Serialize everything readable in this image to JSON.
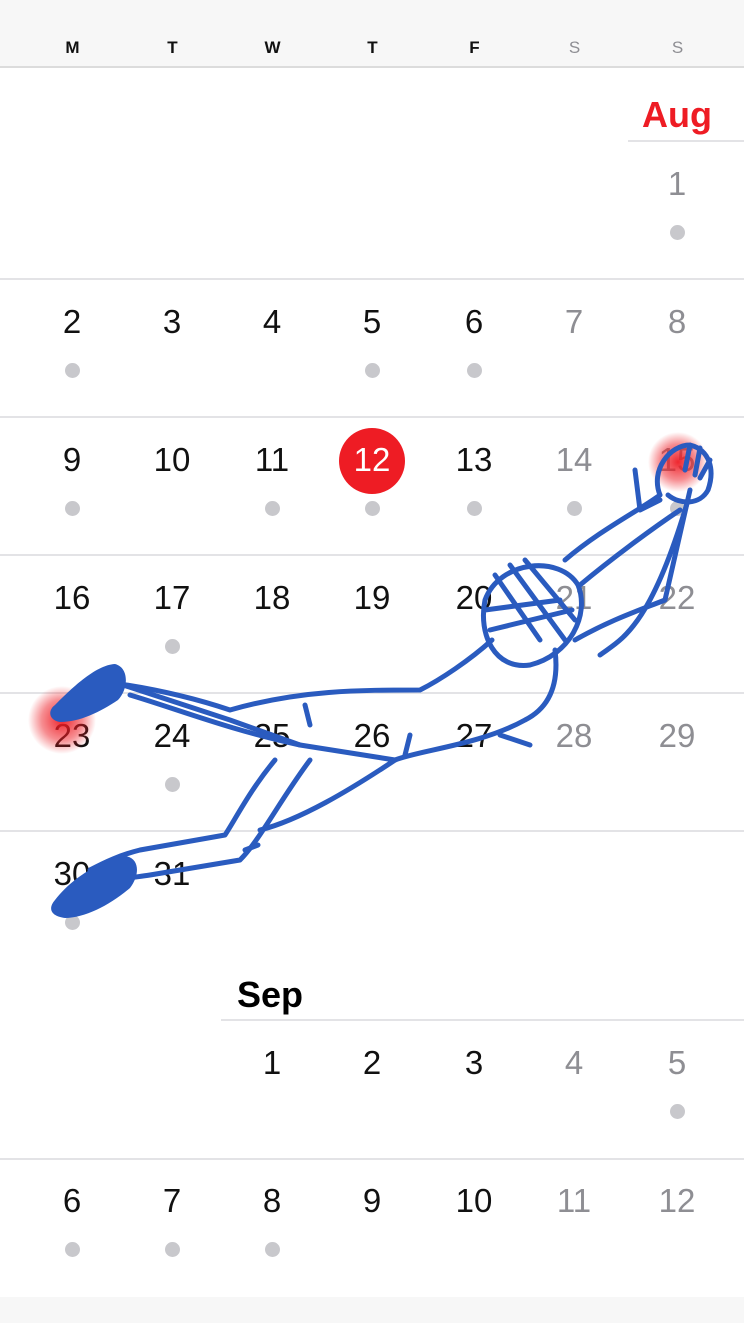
{
  "weekdays": [
    "M",
    "T",
    "W",
    "T",
    "F",
    "S",
    "S"
  ],
  "months": {
    "aug": {
      "label": "Aug",
      "color": "#ee1c24"
    },
    "sep": {
      "label": "Sep",
      "color": "#000000"
    }
  },
  "today": {
    "day": "12",
    "color": "#ee1c24"
  },
  "aug_weeks": [
    [
      null,
      null,
      null,
      null,
      null,
      null,
      {
        "d": "1",
        "dot": true
      }
    ],
    [
      {
        "d": "2",
        "dot": true
      },
      {
        "d": "3"
      },
      {
        "d": "4"
      },
      {
        "d": "5",
        "dot": true
      },
      {
        "d": "6",
        "dot": true
      },
      {
        "d": "7"
      },
      {
        "d": "8"
      }
    ],
    [
      {
        "d": "9",
        "dot": true
      },
      {
        "d": "10"
      },
      {
        "d": "11",
        "dot": true
      },
      {
        "d": "12",
        "dot": true,
        "today": true
      },
      {
        "d": "13",
        "dot": true
      },
      {
        "d": "14",
        "dot": true
      },
      {
        "d": "15",
        "dot": true
      }
    ],
    [
      {
        "d": "16"
      },
      {
        "d": "17",
        "dot": true
      },
      {
        "d": "18"
      },
      {
        "d": "19"
      },
      {
        "d": "20"
      },
      {
        "d": "21"
      },
      {
        "d": "22"
      }
    ],
    [
      {
        "d": "23"
      },
      {
        "d": "24",
        "dot": true
      },
      {
        "d": "25"
      },
      {
        "d": "26"
      },
      {
        "d": "27"
      },
      {
        "d": "28"
      },
      {
        "d": "29"
      }
    ],
    [
      {
        "d": "30",
        "dot": true
      },
      {
        "d": "31"
      },
      null,
      null,
      null,
      null,
      null
    ]
  ],
  "sep_weeks": [
    [
      null,
      null,
      {
        "d": "1"
      },
      {
        "d": "2"
      },
      {
        "d": "3"
      },
      {
        "d": "4"
      },
      {
        "d": "5",
        "dot": true
      }
    ],
    [
      {
        "d": "6",
        "dot": true
      },
      {
        "d": "7",
        "dot": true
      },
      {
        "d": "8",
        "dot": true
      },
      {
        "d": "9"
      },
      {
        "d": "10"
      },
      {
        "d": "11"
      },
      {
        "d": "12"
      }
    ]
  ],
  "drawing": {
    "stroke": "#2a5bbf",
    "glow": "#ee1c24"
  }
}
